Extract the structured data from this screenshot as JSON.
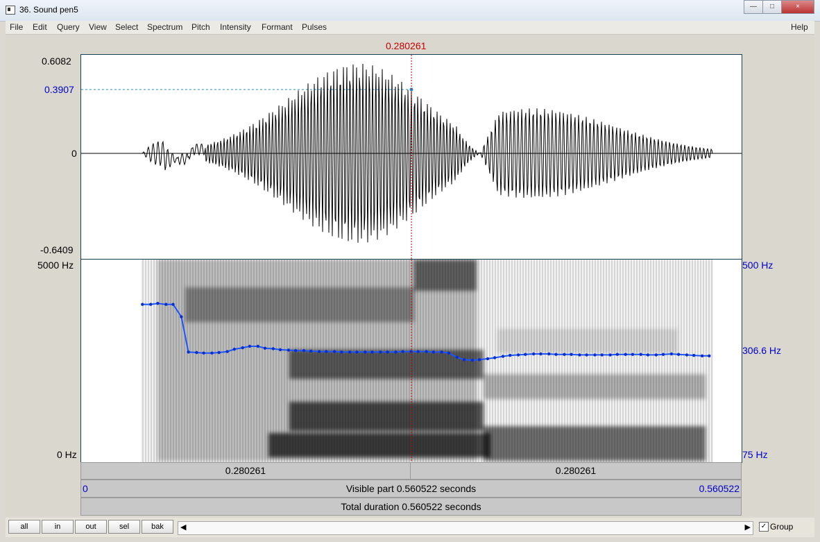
{
  "window": {
    "title": "36. Sound pen5",
    "controls": [
      "minimize",
      "maximize",
      "close"
    ]
  },
  "menu": {
    "left": [
      "File",
      "Edit",
      "Query",
      "View",
      "Select",
      "Spectrum",
      "Pitch",
      "Intensity",
      "Formant",
      "Pulses"
    ],
    "right": "Help"
  },
  "cursor": {
    "time_label": "0.280261"
  },
  "waveform": {
    "max_label": "0.6082",
    "cursor_value_label": "0.3907",
    "zero_label": "0",
    "min_label": "-0.6409"
  },
  "spectrogram": {
    "left_top_label": "5000 Hz",
    "left_bottom_label": "0 Hz",
    "right_top_label": "500 Hz",
    "right_middle_label": "306.6 Hz",
    "right_bottom_label": "75 Hz"
  },
  "timeline": {
    "left_segment": "0.280261",
    "right_segment": "0.280261",
    "visible_start": "0",
    "visible_text": "Visible part 0.560522 seconds",
    "visible_end": "0.560522",
    "total_text": "Total duration 0.560522 seconds"
  },
  "bottom": {
    "buttons": [
      "all",
      "in",
      "out",
      "sel",
      "bak"
    ],
    "group_label": "Group",
    "group_checked": true
  },
  "chart_data": {
    "type": "line",
    "title": "",
    "xlabel": "",
    "ylabel": "",
    "x_unit": "s",
    "y_unit": "Hz",
    "ylim": [
      75,
      500
    ],
    "series": [
      {
        "name": "",
        "color": "#1b55ff",
        "x": [
          0.052,
          0.059,
          0.065,
          0.072,
          0.078,
          0.085,
          0.091,
          0.098,
          0.104,
          0.111,
          0.117,
          0.124,
          0.13,
          0.137,
          0.143,
          0.15,
          0.156,
          0.163,
          0.169,
          0.176,
          0.182,
          0.189,
          0.195,
          0.202,
          0.208,
          0.215,
          0.221,
          0.228,
          0.234,
          0.241,
          0.247,
          0.254,
          0.26,
          0.267,
          0.273,
          0.28,
          0.286,
          0.293,
          0.299,
          0.306,
          0.312,
          0.319,
          0.325,
          0.332,
          0.338,
          0.345,
          0.351,
          0.358,
          0.364,
          0.371,
          0.377,
          0.384,
          0.39,
          0.397,
          0.403,
          0.41,
          0.416,
          0.423,
          0.429,
          0.436,
          0.442,
          0.449,
          0.455,
          0.462,
          0.468,
          0.475,
          0.481,
          0.488,
          0.494,
          0.501,
          0.507,
          0.514,
          0.52,
          0.527,
          0.533
        ],
        "y": [
          406,
          406,
          408,
          406,
          406,
          380,
          306,
          305,
          304,
          304,
          305,
          307,
          312,
          315,
          318,
          318,
          314,
          313,
          311,
          310,
          309,
          309,
          308,
          307,
          307,
          307,
          306,
          306,
          306,
          306,
          306,
          306,
          306,
          306,
          307,
          307,
          307,
          307,
          306,
          306,
          304,
          295,
          290,
          289,
          290,
          292,
          294,
          297,
          299,
          300,
          301,
          302,
          302,
          302,
          301,
          301,
          301,
          300,
          300,
          300,
          300,
          300,
          301,
          301,
          301,
          301,
          300,
          300,
          301,
          302,
          301,
          300,
          299,
          298,
          298
        ]
      }
    ]
  }
}
